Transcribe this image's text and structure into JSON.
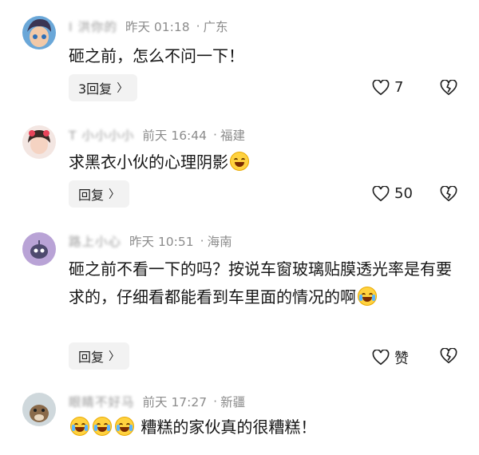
{
  "comments": [
    {
      "name": "I 洪你的",
      "time": "昨天 01:18",
      "location": "广东",
      "text": "砸之前，怎么不问一下！",
      "reply_label": "3回复",
      "likes": "7"
    },
    {
      "name": "T 小小小小",
      "time": "前天 16:44",
      "location": "福建",
      "text": "求黑衣小伙的心理阴影",
      "reply_label": "回复",
      "likes": "50"
    },
    {
      "name": "路上小心",
      "time": "昨天 10:51",
      "location": "海南",
      "text": "砸之前不看一下的吗？按说车窗玻璃贴膜透光率是有要求的，仔细看都能看到车里面的情况的啊",
      "reply_label": "回复",
      "likes": "赞"
    },
    {
      "name": "眼睛不好马",
      "time": "前天 17:27",
      "location": "新疆",
      "text": "糟糕的家伙真的很糟糕！",
      "reply_label": "",
      "likes": ""
    }
  ],
  "icons": {
    "like": "heart-icon",
    "dislike": "broken-heart-icon",
    "chevron": "chevron-right-icon"
  },
  "colors": {
    "meta": "#8c8c8c",
    "reply_bg": "#f2f2f2"
  }
}
